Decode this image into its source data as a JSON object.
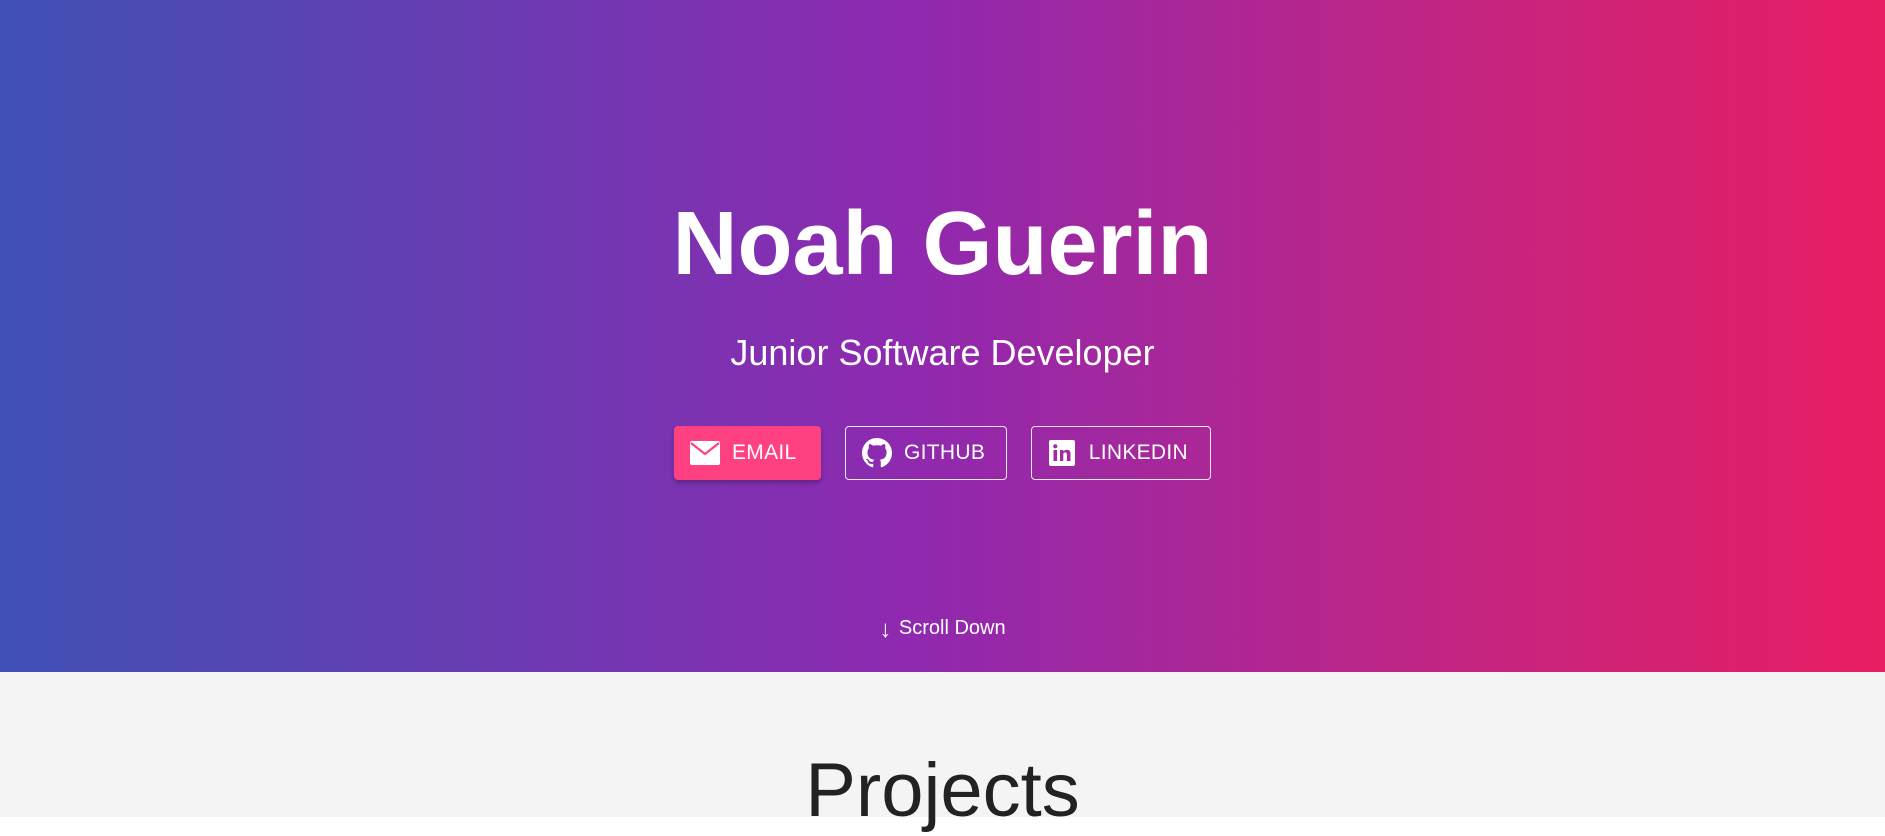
{
  "hero": {
    "name": "Noah Guerin",
    "subtitle": "Junior Software Developer",
    "buttons": {
      "email": "EMAIL",
      "github": "GITHUB",
      "linkedin": "LINKEDIN"
    },
    "scroll": {
      "arrow": "↓",
      "label": "Scroll Down"
    },
    "colors": {
      "gradient_start": "#3f51b5",
      "gradient_end": "#e91e63",
      "email_button": "#ff4081"
    },
    "icons": [
      "envelope-icon",
      "github-icon",
      "linkedin-icon"
    ]
  },
  "projects": {
    "title": "Projects",
    "background": "#f4f4f4"
  }
}
